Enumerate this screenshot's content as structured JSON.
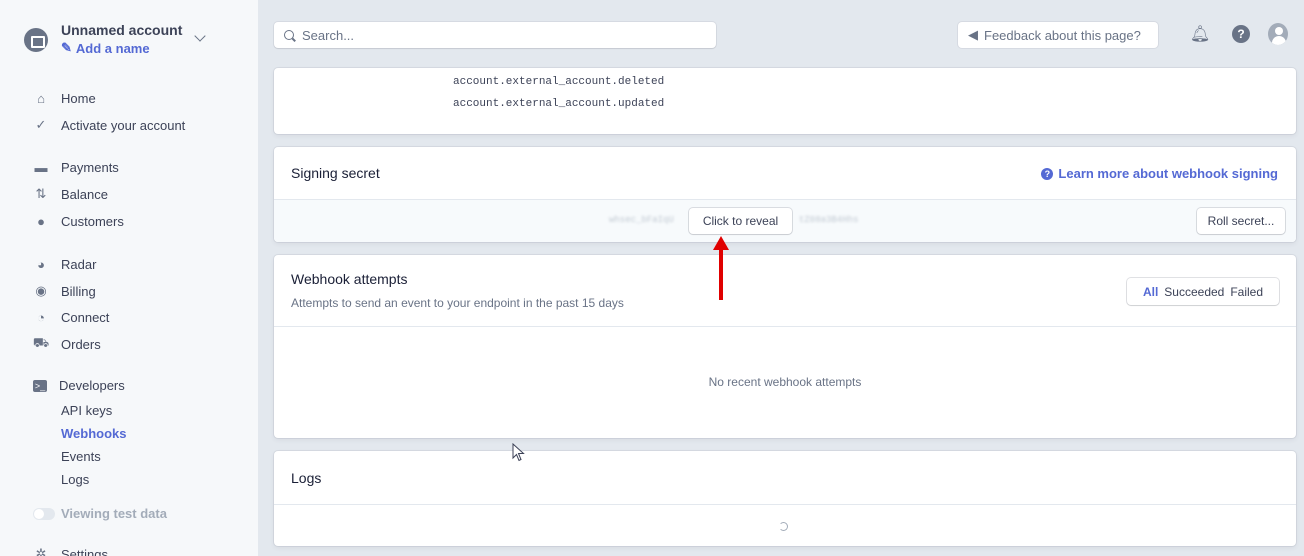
{
  "sidebar": {
    "account_name": "Unnamed account",
    "add_name": "Add a name",
    "nav": [
      {
        "label": "Home",
        "icon": "home-icon"
      },
      {
        "label": "Activate your account",
        "icon": "check-icon"
      },
      {
        "label": "Payments",
        "icon": "payments-icon"
      },
      {
        "label": "Balance",
        "icon": "balance-icon"
      },
      {
        "label": "Customers",
        "icon": "customers-icon"
      },
      {
        "label": "Radar",
        "icon": "radar-icon"
      },
      {
        "label": "Billing",
        "icon": "billing-icon"
      },
      {
        "label": "Connect",
        "icon": "connect-icon"
      },
      {
        "label": "Orders",
        "icon": "orders-icon"
      },
      {
        "label": "Developers",
        "icon": "terminal-icon"
      }
    ],
    "developer_sub": [
      "API keys",
      "Webhooks",
      "Events",
      "Logs"
    ],
    "active_sub": "Webhooks",
    "test_data": "Viewing test data",
    "settings": "Settings"
  },
  "topbar": {
    "search_placeholder": "Search...",
    "feedback": "Feedback about this page?"
  },
  "events_card": {
    "events": [
      "account.external_account.deleted",
      "account.external_account.updated"
    ]
  },
  "signing": {
    "title": "Signing secret",
    "learn_more": "Learn more about webhook signing",
    "secret_blurred_left": "whsec_bFaIqU",
    "secret_blurred_right": "tZ08a3B4Hhs",
    "reveal": "Click to reveal",
    "roll": "Roll secret..."
  },
  "attempts": {
    "title": "Webhook attempts",
    "subtitle": "Attempts to send an event to your endpoint in the past 15 days",
    "filters": [
      "All",
      "Succeeded",
      "Failed"
    ],
    "active_filter": "All",
    "empty": "No recent webhook attempts"
  },
  "logs": {
    "title": "Logs"
  },
  "colors": {
    "accent": "#5469d4",
    "annotation": "#e00000"
  }
}
